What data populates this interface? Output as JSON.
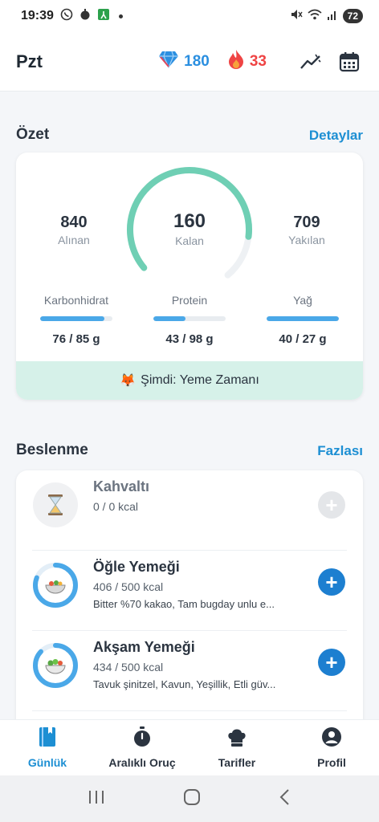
{
  "status_bar": {
    "time": "19:39",
    "battery": "72"
  },
  "header": {
    "day": "Pzt",
    "gems": "180",
    "streak": "33"
  },
  "summary": {
    "title": "Özet",
    "link": "Detaylar",
    "consumed": {
      "value": "840",
      "label": "Alınan"
    },
    "remaining": {
      "value": "160",
      "label": "Kalan",
      "ring_progress": 0.84
    },
    "burned": {
      "value": "709",
      "label": "Yakılan"
    },
    "macros": [
      {
        "name": "Karbonhidrat",
        "value": "76 / 85 g",
        "progress": 0.89
      },
      {
        "name": "Protein",
        "value": "43 / 98 g",
        "progress": 0.44
      },
      {
        "name": "Yağ",
        "value": "40 / 27 g",
        "progress": 1.0
      }
    ],
    "banner_emoji": "🦊",
    "banner_text": "Şimdi: Yeme Zamanı"
  },
  "nutrition": {
    "title": "Beslenme",
    "link": "Fazlası",
    "meals": [
      {
        "name": "Kahvaltı",
        "kcal": "0 / 0 kcal",
        "foods": "",
        "progress": 0,
        "icon": "hourglass-icon"
      },
      {
        "name": "Öğle Yemeği",
        "kcal": "406 / 500 kcal",
        "foods": "Bitter %70 kakao, Tam bugday unlu e...",
        "progress": 0.81,
        "icon": "lunch-bowl-icon"
      },
      {
        "name": "Akşam Yemeği",
        "kcal": "434 / 500 kcal",
        "foods": "Tavuk şinitzel, Kavun, Yeşillik, Etli güv...",
        "progress": 0.87,
        "icon": "salad-icon"
      }
    ]
  },
  "tabs": [
    {
      "label": "Günlük",
      "active": true,
      "icon": "diary-icon"
    },
    {
      "label": "Aralıklı Oruç",
      "active": false,
      "icon": "stopwatch-icon"
    },
    {
      "label": "Tarifler",
      "active": false,
      "icon": "chef-hat-icon"
    },
    {
      "label": "Profil",
      "active": false,
      "icon": "profile-icon"
    }
  ],
  "colors": {
    "accent": "#1d8fd3",
    "ring": "#6fcfb4",
    "gem": "#2b8fe0",
    "streak": "#ef4444",
    "banner": "#d6f1e9"
  }
}
